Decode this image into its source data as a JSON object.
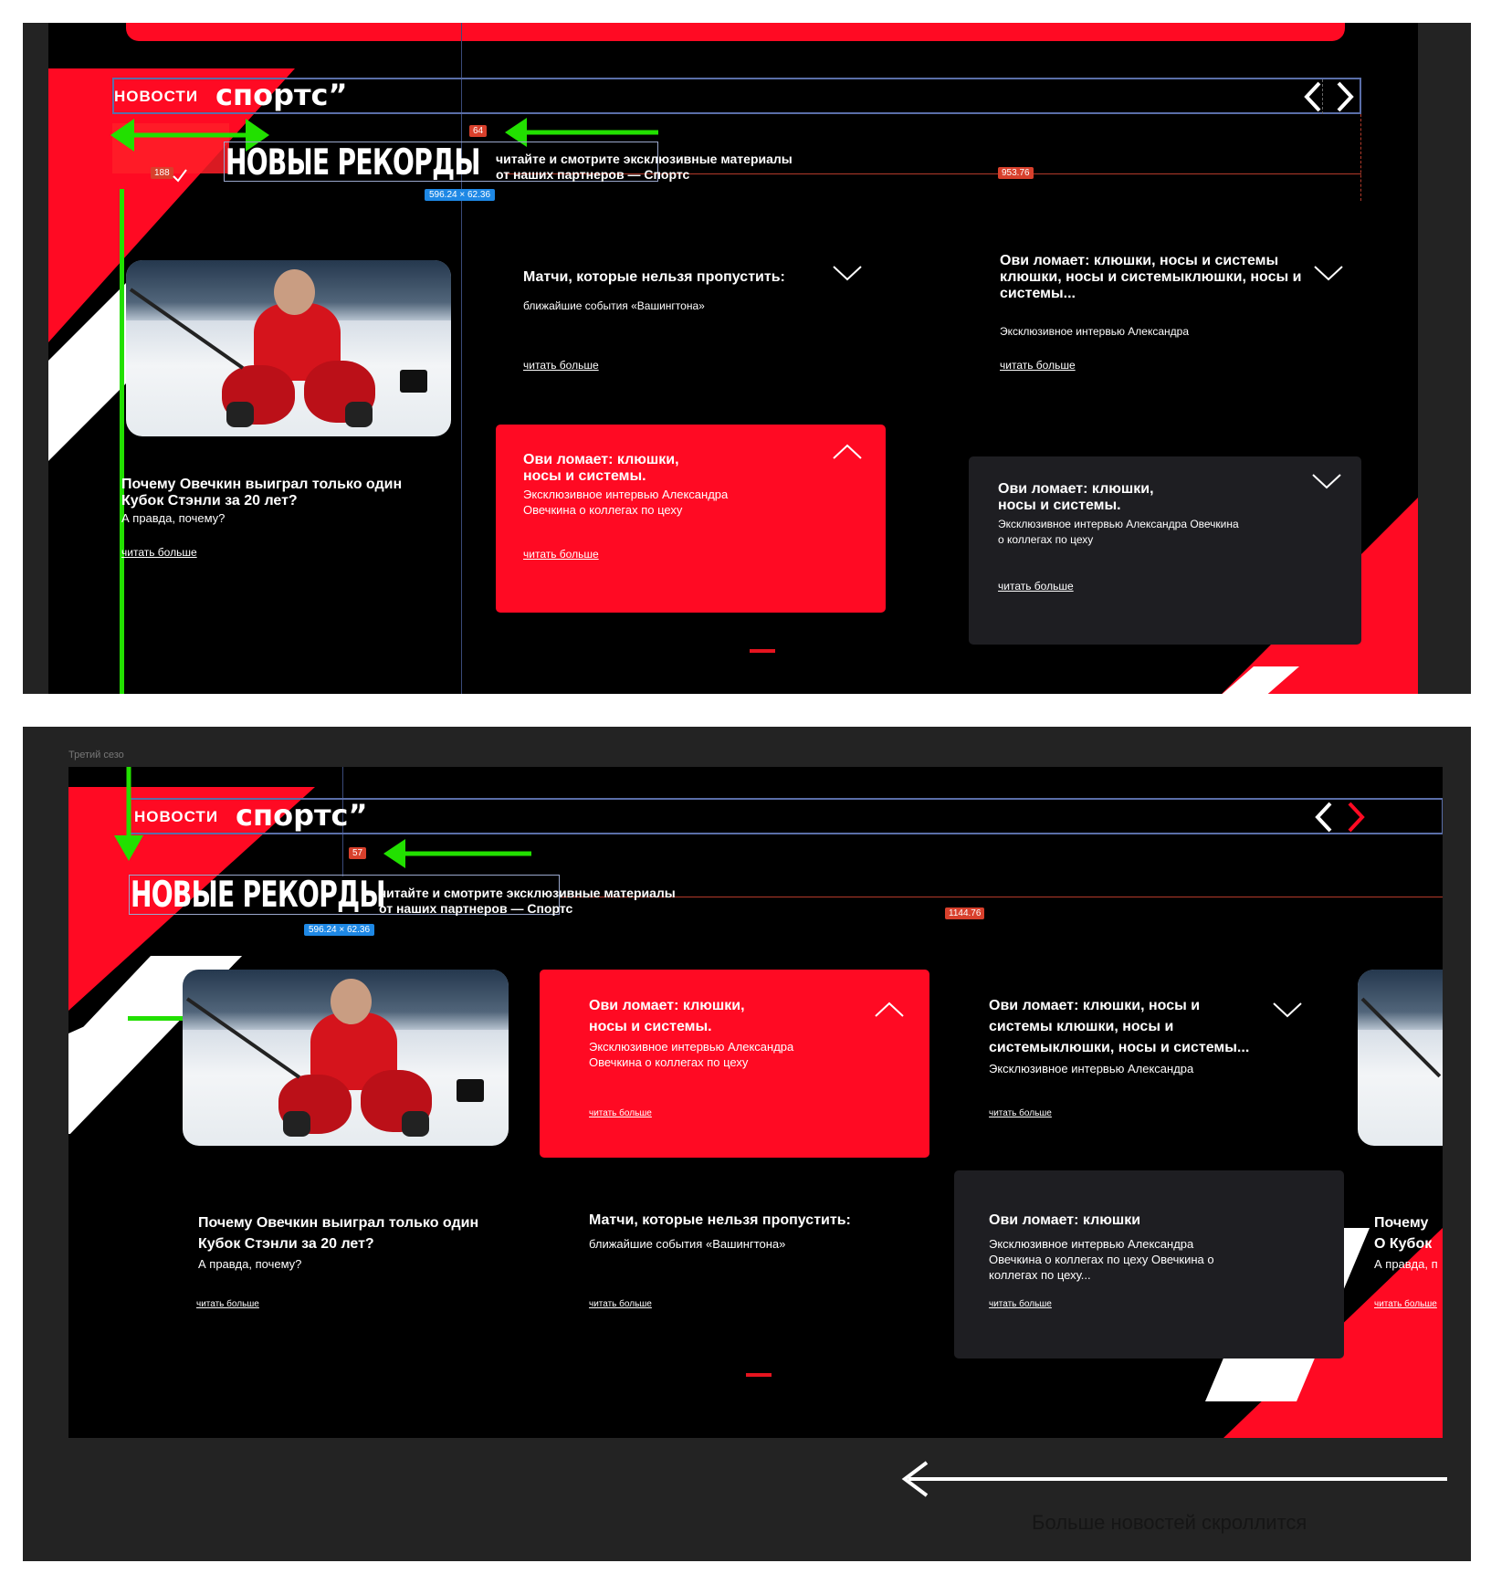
{
  "colors": {
    "accent": "#ff0a23",
    "background": "#000000",
    "card_dark": "#1e1e22",
    "annotation_green": "#22e000",
    "annotation_orange": "#d8402c",
    "annotation_blue": "#1e88e5"
  },
  "top_frame": {
    "brand_news": "НОВОСТИ",
    "brand_sports": "спортс”",
    "headline": "НОВЫЕ РЕКОРДЫ",
    "tagline_line1": "читайте и смотрите эксклюзивные материалы",
    "tagline_line2": "от наших партнеров — Спортс",
    "measure_64": "64",
    "measure_188": "188",
    "measure_953": "953.76",
    "size_label": "596.24 × 62.36",
    "cards": {
      "feature": {
        "title": "Почему Овечкин выиграл только один Кубок Стэнли за 20 лет?",
        "subtitle": "А правда, почему?",
        "read_more": "читать больше"
      },
      "matches": {
        "title": "Матчи, которые нельзя пропустить:",
        "subtitle": "ближайшие события «Вашингтона»",
        "read_more": "читать больше"
      },
      "ovi_long": {
        "title": "Ови ломает: клюшки, носы и системы клюшки, носы и системыклюшки, носы и системы...",
        "subtitle": "Эксклюзивное интервью Александра",
        "read_more": "читать больше"
      },
      "ovi_red": {
        "title": "Ови ломает: клюшки, носы и системы.",
        "subtitle": "Эксклюзивное интервью Александра Овечкина о коллегах по цеху",
        "read_more": "читать больше"
      },
      "ovi_dark": {
        "title": "Ови ломает: клюшки, носы и системы.",
        "subtitle": "Эксклюзивное интервью Александра Овечкина о коллегах по цеху",
        "read_more": "читать больше"
      }
    }
  },
  "bottom_frame": {
    "frame_label": "Третий сезо",
    "brand_news": "НОВОСТИ",
    "brand_sports": "спортс”",
    "headline": "НОВЫЕ РЕКОРДЫ",
    "tagline_line1": "читайте и смотрите эксклюзивные материалы",
    "tagline_line2": "от наших партнеров — Спортс",
    "measure_57": "57",
    "measure_1144": "1144.76",
    "size_label": "596.24 × 62.36",
    "cards": {
      "ovi_red": {
        "title": "Ови ломает: клюшки, носы и системы.",
        "subtitle": "Эксклюзивное интервью Александра Овечкина о коллегах по цеху",
        "read_more": "читать больше"
      },
      "ovi_long": {
        "title": "Ови ломает: клюшки, носы и системы клюшки, носы и системыклюшки, носы и системы...",
        "subtitle": "Эксклюзивное интервью Александра",
        "read_more": "читать больше"
      },
      "feature": {
        "title": "Почему Овечкин выиграл только один Кубок Стэнли за 20 лет?",
        "subtitle": "А правда, почему?",
        "read_more": "читать больше"
      },
      "matches": {
        "title": "Матчи, которые нельзя пропустить:",
        "subtitle": "ближайшие события «Вашингтона»",
        "read_more": "читать больше"
      },
      "ovi_dark": {
        "title": "Ови ломает: клюшки",
        "subtitle": "Эксклюзивное интервью Александра Овечкина о коллегах по цеху Овечкина о коллегах по цеху...",
        "read_more": "читать больше"
      },
      "partial": {
        "title": "Почему О Кубок Ст",
        "subtitle": "А правда, п",
        "read_more": "читать больше"
      }
    }
  },
  "scroll_note": "Больше новостей скроллится"
}
